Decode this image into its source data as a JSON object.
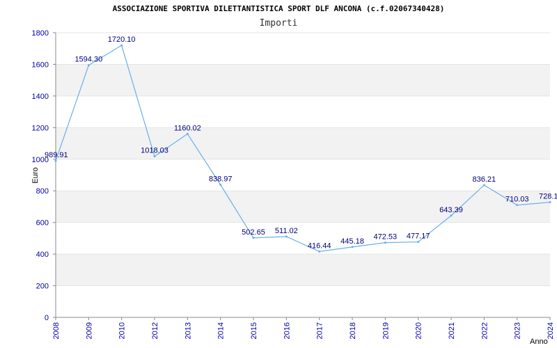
{
  "chart_data": {
    "type": "line",
    "title": "ASSOCIAZIONE SPORTIVA DILETTANTISTICA SPORT DLF ANCONA (c.f.02067340428)",
    "subtitle": "Importi",
    "xlabel": "Anno",
    "ylabel": "Euro",
    "ylim": [
      0,
      1800
    ],
    "yticks": [
      0,
      200,
      400,
      600,
      800,
      1000,
      1200,
      1400,
      1600,
      1800
    ],
    "grid": "horizontal alternating bands",
    "categories": [
      "2008",
      "2009",
      "2010",
      "2012",
      "2013",
      "2014",
      "2015",
      "2016",
      "2017",
      "2018",
      "2019",
      "2020",
      "2021",
      "2022",
      "2023",
      "2024"
    ],
    "series": [
      {
        "values": [
          989.91,
          1594.3,
          1720.1,
          1018.03,
          1160.02,
          838.97,
          502.65,
          511.02,
          416.44,
          445.18,
          472.53,
          477.17,
          643.39,
          836.21,
          710.03,
          728.1
        ],
        "value_labels": [
          "989.91",
          "1594.30",
          "1720.10",
          "1018.03",
          "1160.02",
          "838.97",
          "502.65",
          "511.02",
          "416.44",
          "445.18",
          "472.53",
          "477.17",
          "643.39",
          "836.21",
          "710.03",
          "728.1"
        ],
        "color": "#6aaee8"
      }
    ],
    "colors": {
      "band": "#f2f2f2",
      "tick_text": "#0000b0",
      "label_text": "#000080",
      "axis": "#888888"
    }
  }
}
